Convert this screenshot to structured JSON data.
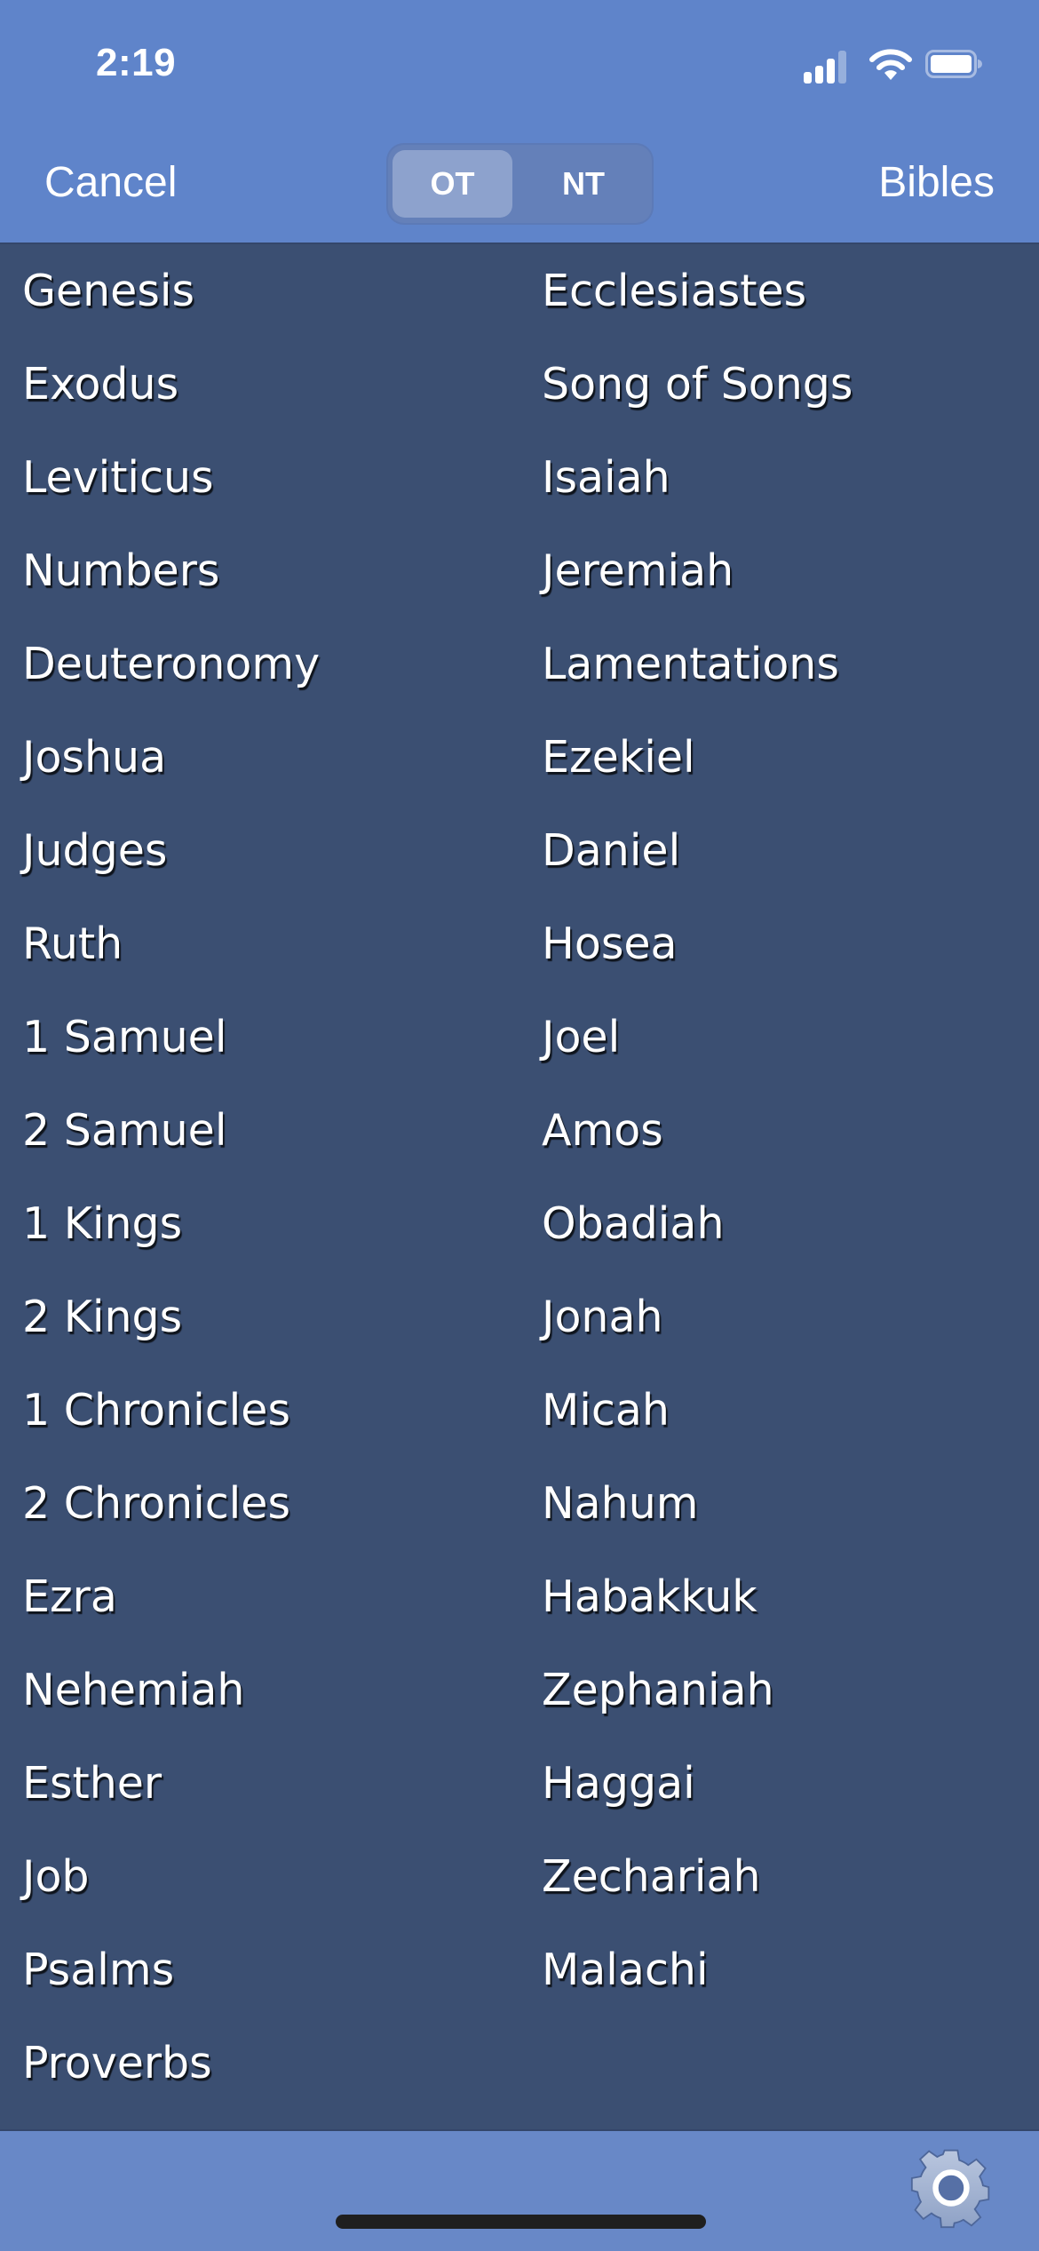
{
  "status_bar": {
    "time": "2:19",
    "signal_bars_active": 3,
    "signal_bars_total": 4,
    "wifi": "wifi-icon",
    "battery_level": 0.9
  },
  "nav": {
    "cancel_label": "Cancel",
    "bibles_label": "Bibles",
    "segments": [
      {
        "label": "OT",
        "selected": true
      },
      {
        "label": "NT",
        "selected": false
      }
    ]
  },
  "books": {
    "left": [
      "Genesis",
      "Exodus",
      "Leviticus",
      "Numbers",
      "Deuteronomy",
      "Joshua",
      "Judges",
      "Ruth",
      "1 Samuel",
      "2 Samuel",
      "1 Kings",
      "2 Kings",
      "1 Chronicles",
      "2 Chronicles",
      "Ezra",
      "Nehemiah",
      "Esther",
      "Job",
      "Psalms",
      "Proverbs"
    ],
    "right": [
      "Ecclesiastes",
      "Song of Songs",
      "Isaiah",
      "Jeremiah",
      "Lamentations",
      "Ezekiel",
      "Daniel",
      "Hosea",
      "Joel",
      "Amos",
      "Obadiah",
      "Jonah",
      "Micah",
      "Nahum",
      "Habakkuk",
      "Zephaniah",
      "Haggai",
      "Zechariah",
      "Malachi"
    ]
  },
  "bottom_bar": {
    "settings_icon": "gear-icon"
  },
  "colors": {
    "header_bg": "#5F84CA",
    "list_bg": "#3B4F72",
    "bottom_bar_bg": "#6888C7",
    "segment_selected_bg": "#8DA2CD",
    "segment_bg": "#6480B9",
    "text": "#FFFFFF"
  }
}
